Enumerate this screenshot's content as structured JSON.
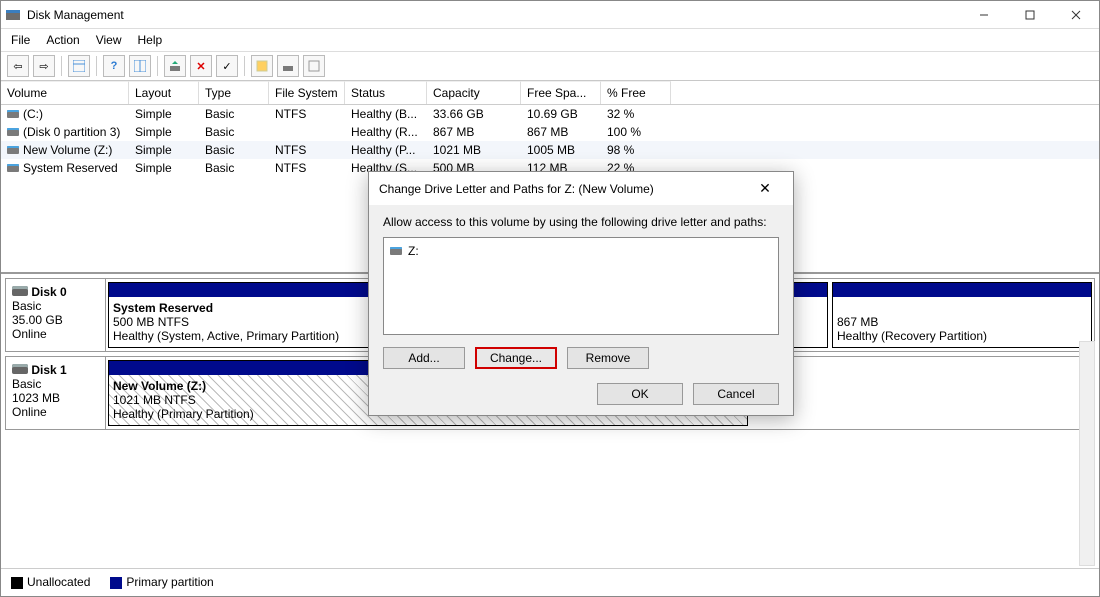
{
  "window": {
    "title": "Disk Management"
  },
  "menubar": {
    "file": "File",
    "action": "Action",
    "view": "View",
    "help": "Help"
  },
  "vol_head": {
    "volume": "Volume",
    "layout": "Layout",
    "type": "Type",
    "fs": "File System",
    "status": "Status",
    "cap": "Capacity",
    "free": "Free Spa...",
    "pct": "% Free"
  },
  "volumes": [
    {
      "name": "(C:)",
      "layout": "Simple",
      "type": "Basic",
      "fs": "NTFS",
      "status": "Healthy (B...",
      "cap": "33.66 GB",
      "free": "10.69 GB",
      "pct": "32 %"
    },
    {
      "name": "(Disk 0 partition 3)",
      "layout": "Simple",
      "type": "Basic",
      "fs": "",
      "status": "Healthy (R...",
      "cap": "867 MB",
      "free": "867 MB",
      "pct": "100 %"
    },
    {
      "name": "New Volume (Z:)",
      "layout": "Simple",
      "type": "Basic",
      "fs": "NTFS",
      "status": "Healthy (P...",
      "cap": "1021 MB",
      "free": "1005 MB",
      "pct": "98 %"
    },
    {
      "name": "System Reserved",
      "layout": "Simple",
      "type": "Basic",
      "fs": "NTFS",
      "status": "Healthy (S...",
      "cap": "500 MB",
      "free": "112 MB",
      "pct": "22 %"
    }
  ],
  "disks": {
    "d0": {
      "name": "Disk 0",
      "type": "Basic",
      "size": "35.00 GB",
      "state": "Online",
      "p0": {
        "title": "System Reserved",
        "line1": "500 MB NTFS",
        "line2": "Healthy (System, Active, Primary Partition)"
      },
      "p1": {
        "title": "",
        "line1": "867 MB",
        "line2": "Healthy (Recovery Partition)"
      }
    },
    "d1": {
      "name": "Disk 1",
      "type": "Basic",
      "size": "1023 MB",
      "state": "Online",
      "p0": {
        "title": "New Volume  (Z:)",
        "line1": "1021 MB NTFS",
        "line2": "Healthy (Primary Partition)"
      }
    }
  },
  "legend": {
    "unalloc": "Unallocated",
    "primary": "Primary partition"
  },
  "dialog": {
    "title": "Change Drive Letter and Paths for Z: (New Volume)",
    "instr": "Allow access to this volume by using the following drive letter and paths:",
    "entry": "Z:",
    "btn_add": "Add...",
    "btn_change": "Change...",
    "btn_remove": "Remove",
    "btn_ok": "OK",
    "btn_cancel": "Cancel"
  }
}
